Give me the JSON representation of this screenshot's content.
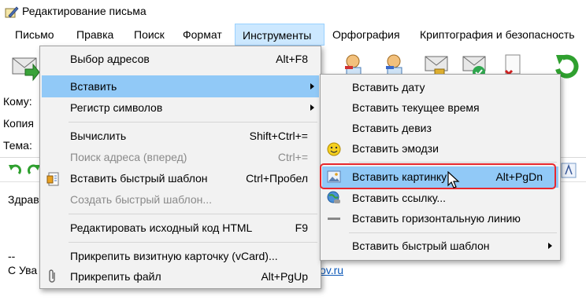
{
  "window": {
    "title": "Редактирование письма"
  },
  "menubar": {
    "items": [
      "Письмо",
      "Правка",
      "Поиск",
      "Формат",
      "Инструменты",
      "Орфография",
      "Криптография и безопасность"
    ]
  },
  "fields": {
    "to_label": "Кому:",
    "cc_label": "Копия",
    "subject_label": "Тема:"
  },
  "body": {
    "greeting_fragment": "Здрав",
    "signature_dash": "--",
    "signature_fragment": "С Ува",
    "link_fragment": "ov.ru"
  },
  "tools_menu": {
    "items": [
      {
        "label": "Выбор адресов",
        "shortcut": "Alt+F8"
      },
      {
        "label": "Вставить",
        "shortcut": ""
      },
      {
        "label": "Регистр символов",
        "shortcut": ""
      },
      {
        "label": "Вычислить",
        "shortcut": "Shift+Ctrl+="
      },
      {
        "label": "Поиск адреса (вперед)",
        "shortcut": "Ctrl+="
      },
      {
        "label": "Вставить быстрый шаблон",
        "shortcut": "Ctrl+Пробел"
      },
      {
        "label": "Создать быстрый шаблон...",
        "shortcut": ""
      },
      {
        "label": "Редактировать исходный код HTML",
        "shortcut": "F9"
      },
      {
        "label": "Прикрепить визитную карточку (vCard)...",
        "shortcut": ""
      },
      {
        "label": "Прикрепить файл",
        "shortcut": "Alt+PgUp"
      }
    ]
  },
  "insert_submenu": {
    "items": [
      {
        "label": "Вставить дату",
        "shortcut": ""
      },
      {
        "label": "Вставить текущее время",
        "shortcut": ""
      },
      {
        "label": "Вставить девиз",
        "shortcut": ""
      },
      {
        "label": "Вставить эмодзи",
        "shortcut": ""
      },
      {
        "label": "Вставить картинку",
        "shortcut": "Alt+PgDn"
      },
      {
        "label": "Вставить ссылку...",
        "shortcut": ""
      },
      {
        "label": "Вставить горизонтальную линию",
        "shortcut": ""
      },
      {
        "label": "Вставить быстрый шаблон",
        "shortcut": ""
      }
    ]
  },
  "colors": {
    "highlight": "#91c9f7",
    "menubar_active": "#cce8ff",
    "annotation": "#e8272d"
  }
}
